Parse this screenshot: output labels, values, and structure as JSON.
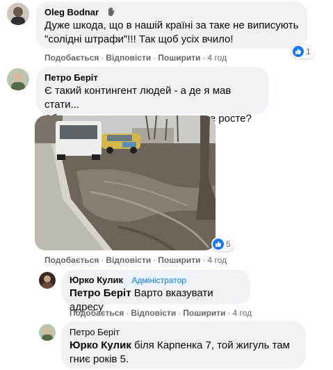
{
  "actions": {
    "like": "Подобається",
    "reply": "Відповісти",
    "share": "Поширити",
    "dot": "·"
  },
  "comments": [
    {
      "author": "Oleg Bodnar",
      "line1": "Дуже шкода, що в нашій країні за таке не виписують",
      "line2": "\"солідні штрафи\"!!! Так щоб усіх вчило!",
      "time": "4 год",
      "reactions": "1"
    },
    {
      "author": "Петро Беріт",
      "line1": "Є такий контингент людей - а де я мав стати...",
      "line2": "Або ж аргумент - ну там трава ж не росте?",
      "time": "4 год",
      "photo_reactions": "5"
    },
    {
      "author": "Юрко Кулик",
      "badge": "Адміністратор",
      "mention": "Петро Беріт",
      "text": "Варто вказувати адресу",
      "time": "4 год"
    },
    {
      "author": "Петро Беріт",
      "mention": "Юрко Кулик",
      "line1_rest": "біля Карпенка 7, той жигуль там",
      "line2": "гниє років 5."
    }
  ],
  "colors": {
    "bubble": "#f0f2f5",
    "like_blue": "#1877f2",
    "meta_gray": "#65676b"
  },
  "icons": [
    "wave-hand-icon",
    "like-icon"
  ]
}
